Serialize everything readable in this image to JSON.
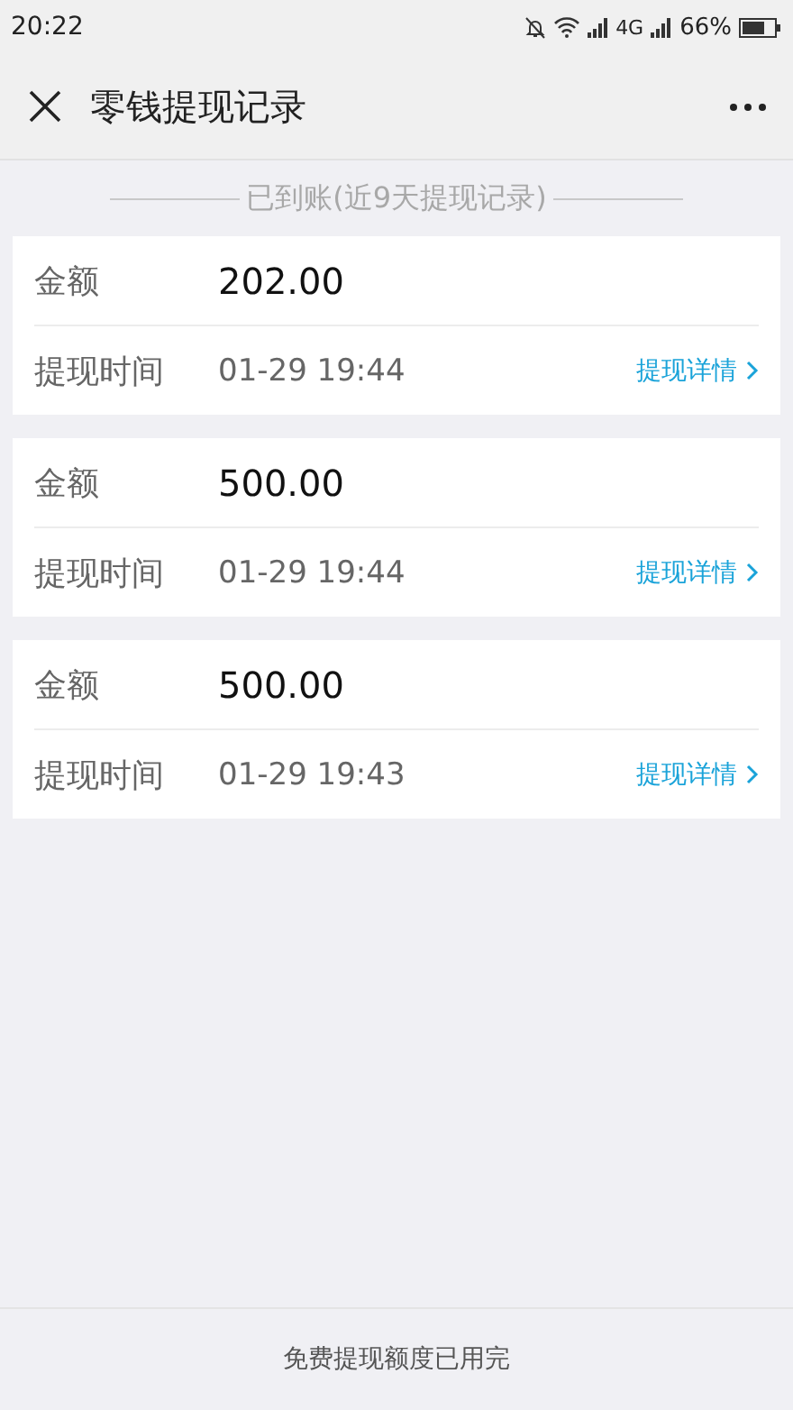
{
  "status_bar": {
    "time": "20:22",
    "network": "4G",
    "battery": "66%"
  },
  "nav": {
    "title": "零钱提现记录"
  },
  "section_label": "已到账(近9天提现记录)",
  "records": [
    {
      "amount_label": "金额",
      "amount": "202.00",
      "time_label": "提现时间",
      "time": "01-29 19:44",
      "detail_link": "提现详情"
    },
    {
      "amount_label": "金额",
      "amount": "500.00",
      "time_label": "提现时间",
      "time": "01-29 19:44",
      "detail_link": "提现详情"
    },
    {
      "amount_label": "金额",
      "amount": "500.00",
      "time_label": "提现时间",
      "time": "01-29 19:43",
      "detail_link": "提现详情"
    }
  ],
  "footer": "免费提现额度已用完"
}
